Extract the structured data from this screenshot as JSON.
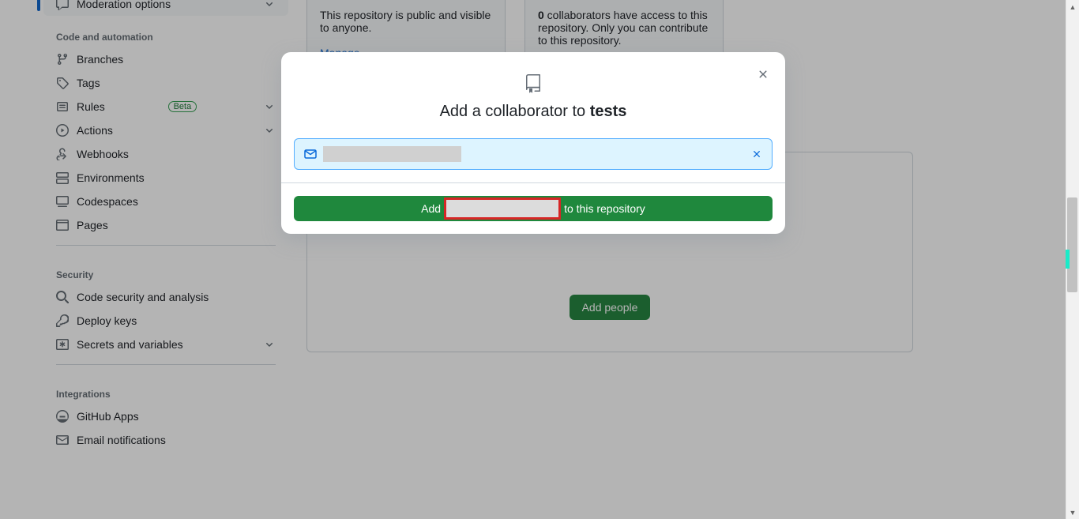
{
  "sidebar": {
    "moderation": "Moderation options",
    "sections": {
      "code_automation": {
        "header": "Code and automation",
        "items": [
          {
            "label": "Branches"
          },
          {
            "label": "Tags"
          },
          {
            "label": "Rules",
            "badge": "Beta"
          },
          {
            "label": "Actions"
          },
          {
            "label": "Webhooks"
          },
          {
            "label": "Environments"
          },
          {
            "label": "Codespaces"
          },
          {
            "label": "Pages"
          }
        ]
      },
      "security": {
        "header": "Security",
        "items": [
          {
            "label": "Code security and analysis"
          },
          {
            "label": "Deploy keys"
          },
          {
            "label": "Secrets and variables"
          }
        ]
      },
      "integrations": {
        "header": "Integrations",
        "items": [
          {
            "label": "GitHub Apps"
          },
          {
            "label": "Email notifications"
          }
        ]
      }
    }
  },
  "main": {
    "visibility_text": "This repository is public and visible to anyone.",
    "manage_link": "Manage",
    "collab_count": "0",
    "collab_text": " collaborators have access to this repository. Only you can contribute to this repository.",
    "add_people": "Add people"
  },
  "modal": {
    "title_prefix": "Add a collaborator to ",
    "title_repo": "tests",
    "input_value": "",
    "submit_prefix": "Add ",
    "submit_suffix": "to this repository"
  }
}
